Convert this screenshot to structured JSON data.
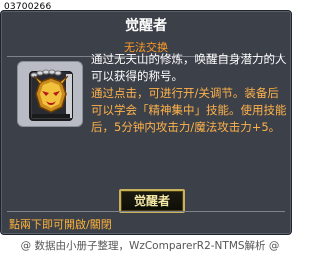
{
  "header": {
    "item_code": "03700266"
  },
  "card": {
    "title": "觉醒者",
    "subtitle": "无法交换",
    "description": [
      {
        "text": "通过无天山的修炼，唤醒自身潜力的人可以获得的称号。",
        "color": "white"
      },
      {
        "text": "通过点击，可进行开/关调节。装备后可以学会「精神集中」技能。使用技能后，5分钟内攻击力/魔法攻击力+5。",
        "color": "orange"
      }
    ],
    "button_label": "觉醒者",
    "bottom_note": "點兩下即可開啟/關閉",
    "icon": "golden-demon-mask-book-icon"
  },
  "footer": {
    "credit": "@ 数据由小册子整理，WzComparerR2-NTMS解析 @"
  },
  "colors": {
    "panel": "#3c4049",
    "accent": "#ff9b26",
    "highlight": "#ffb24a"
  }
}
